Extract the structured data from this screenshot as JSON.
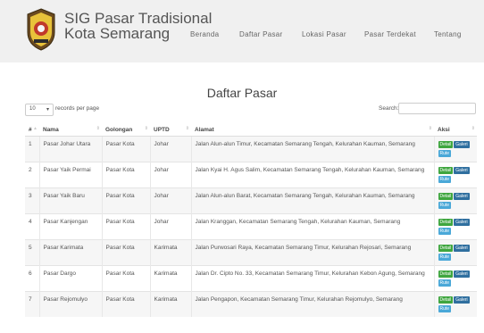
{
  "brand": {
    "line1": "SIG Pasar Tradisional",
    "line2": "Kota Semarang",
    "logo_icon": "semarang-city-emblem"
  },
  "nav": {
    "beranda": "Beranda",
    "daftar": "Daftar Pasar",
    "lokasi": "Lokasi Pasar",
    "terdekat": "Pasar Terdekat",
    "tentang": "Tentang"
  },
  "page": {
    "title": "Daftar Pasar"
  },
  "controls": {
    "length_value": "10",
    "length_label": "records per page",
    "search_label": "Search:",
    "search_value": ""
  },
  "table": {
    "headers": {
      "no": "#",
      "nama": "Nama",
      "golongan": "Golongan",
      "uptd": "UPTD",
      "alamat": "Alamat",
      "aksi": "Aksi"
    },
    "buttons": {
      "detail": "Detail",
      "galeri": "Galeri",
      "rute": "Rute"
    },
    "rows": [
      {
        "no": "1",
        "nama": "Pasar Johar Utara",
        "golongan": "Pasar Kota",
        "uptd": "Johar",
        "alamat": "Jalan Alun-alun Timur, Kecamatan Semarang Tengah, Kelurahan Kauman, Semarang"
      },
      {
        "no": "2",
        "nama": "Pasar Yaik Permai",
        "golongan": "Pasar Kota",
        "uptd": "Johar",
        "alamat": "Jalan Kyai H. Agus Salim, Kecamatan Semarang Tengah, Kelurahan Kauman, Semarang"
      },
      {
        "no": "3",
        "nama": "Pasar Yaik Baru",
        "golongan": "Pasar Kota",
        "uptd": "Johar",
        "alamat": "Jalan Alun-alun Barat, Kecamatan Semarang Tengah, Kelurahan Kauman, Semarang"
      },
      {
        "no": "4",
        "nama": "Pasar Kanjengan",
        "golongan": "Pasar Kota",
        "uptd": "Johar",
        "alamat": "Jalan Kranggan, Kecamatan Semarang Tengah, Kelurahan Kauman, Semarang"
      },
      {
        "no": "5",
        "nama": "Pasar Karimata",
        "golongan": "Pasar Kota",
        "uptd": "Karimata",
        "alamat": "Jalan Purwosari Raya, Kecamatan Semarang Timur, Kelurahan Rejosari, Semarang"
      },
      {
        "no": "6",
        "nama": "Pasar Dargo",
        "golongan": "Pasar Kota",
        "uptd": "Karimata",
        "alamat": "Jalan Dr. Cipto No. 33, Kecamatan Semarang Timur, Kelurahan Kebon Agung, Semarang"
      },
      {
        "no": "7",
        "nama": "Pasar Rejomulyo",
        "golongan": "Pasar Kota",
        "uptd": "Karimata",
        "alamat": "Jalan Pengapon, Kecamatan Semarang Timur, Kelurahan Rejomulyo, Semarang"
      }
    ]
  }
}
